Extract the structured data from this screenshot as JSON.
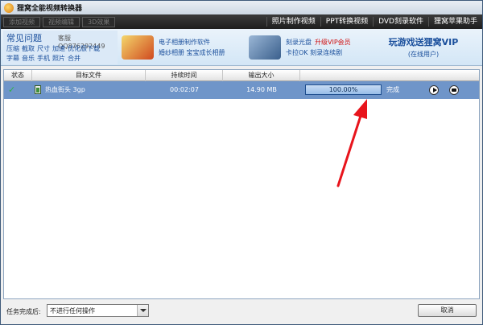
{
  "window": {
    "title": "狸窝全能视频转换器"
  },
  "toolbar": {
    "add_video": "添加视频",
    "video_edit": "视频编辑",
    "effect_3d": "3D效果",
    "links": [
      "照片制作视频",
      "PPT转换视频",
      "DVD刻录软件",
      "狸窝苹果助手"
    ]
  },
  "banner": {
    "faq_title": "常见问题",
    "service": "客服QQ876292449",
    "faq_row1": [
      "压缩",
      "截取",
      "尺寸",
      "加速",
      "优化版下载"
    ],
    "faq_row2": [
      "字幕",
      "音乐",
      "手机",
      "照片",
      "合并"
    ],
    "promo1": [
      "电子相册制作软件",
      "婚纱相册 宝宝成长相册"
    ],
    "promo2_line1": "刻录光盘",
    "promo2_vip": "升级VIP会员",
    "promo2_line2": "卡拉OK 刻录连续剧",
    "vip_title": "玩游戏送狸窝VIP",
    "vip_sub": "(在线用户)"
  },
  "table": {
    "headers": [
      "状态",
      "目标文件",
      "持续时间",
      "输出大小"
    ],
    "rows": [
      {
        "status_icon": "check-icon",
        "file": "热血街头 3gp",
        "duration": "00:02:07",
        "size": "14.90 MB",
        "progress": 100,
        "progress_text": "100.00%",
        "state": "完成"
      }
    ]
  },
  "bottom": {
    "after_label": "任务完成后:",
    "after_option": "不进行任何操作",
    "cancel": "取消"
  },
  "colors": {
    "row_selected": "#6f95c9",
    "annotation_arrow": "#e8141c",
    "link": "#1a4f9c"
  }
}
